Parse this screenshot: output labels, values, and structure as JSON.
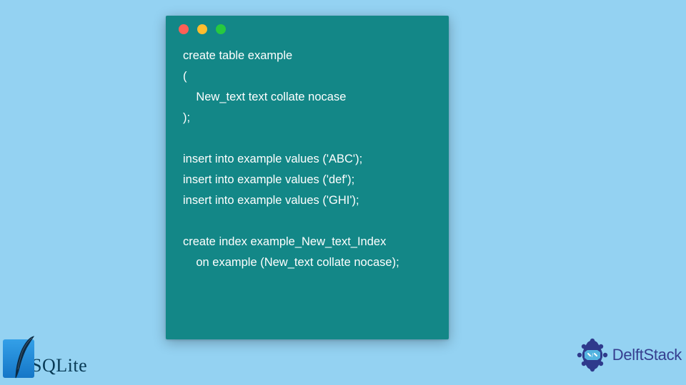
{
  "window": {
    "buttons": [
      "close",
      "minimize",
      "zoom"
    ]
  },
  "code_lines": [
    "create table example",
    "(",
    "    New_text text collate nocase",
    ");",
    "",
    "insert into example values ('ABC');",
    "insert into example values ('def');",
    "insert into example values ('GHI');",
    "",
    "create index example_New_text_Index",
    "    on example (New_text collate nocase);"
  ],
  "sqlite": {
    "text": "SQLite"
  },
  "delftstack": {
    "text": "DelftStack"
  }
}
